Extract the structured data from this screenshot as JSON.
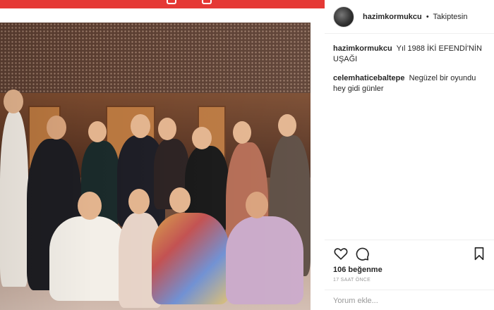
{
  "post": {
    "author": "hazimkormukcu",
    "separator": "•",
    "follow_status": "Takiptesin",
    "caption": {
      "user": "hazimkormukcu",
      "text": "Yıl 1988 İKİ EFENDİ'NİN UŞAĞI"
    },
    "comments": [
      {
        "user": "celemhaticebaltepe",
        "text": "Negüzel bir oyundu hey gidi günler"
      }
    ],
    "likes": "106 beğenme",
    "timestamp": "17 SAAT ÖNCE",
    "comment_placeholder": "Yorum ekle..."
  },
  "icons": {
    "like": "heart-icon",
    "comment": "comment-bubble-icon",
    "save": "bookmark-icon",
    "avatar": "avatar"
  },
  "colors": {
    "top_bar": "#e53935",
    "text": "#262626",
    "muted": "#999999",
    "divider": "#efefef"
  }
}
